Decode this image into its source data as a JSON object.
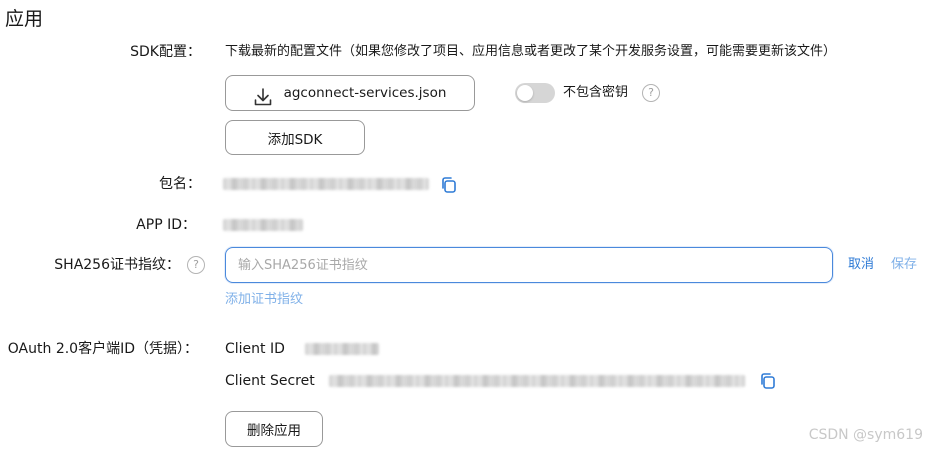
{
  "section": {
    "title": "应用"
  },
  "sdk": {
    "label": "SDK配置：",
    "description": "下载最新的配置文件（如果您修改了项目、应用信息或者更改了某个开发服务设置，可能需要更新该文件）",
    "download_button": "agconnect-services.json",
    "download_icon": "download-icon",
    "toggle_label": "不包含密钥",
    "toggle_on": false,
    "help_glyph": "?",
    "add_sdk_button": "添加SDK"
  },
  "package": {
    "label": "包名：",
    "copy_icon": "copy-icon"
  },
  "app_id": {
    "label": "APP ID："
  },
  "sha256": {
    "label": "SHA256证书指纹：",
    "help_glyph": "?",
    "input_value": "",
    "placeholder": "输入SHA256证书指纹",
    "cancel_label": "取消",
    "save_label": "保存",
    "add_link": "添加证书指纹"
  },
  "oauth": {
    "label": "OAuth 2.0客户端ID（凭据）：",
    "client_id_label": "Client ID",
    "client_secret_label": "Client Secret",
    "copy_icon": "copy-icon"
  },
  "delete_button": "删除应用",
  "watermark": "CSDN @sym619",
  "colors": {
    "accent": "#2f7bd6",
    "input_border": "#4a89dc",
    "toggle_off": "#d6d6d6",
    "link_light": "#7fb0e8"
  }
}
